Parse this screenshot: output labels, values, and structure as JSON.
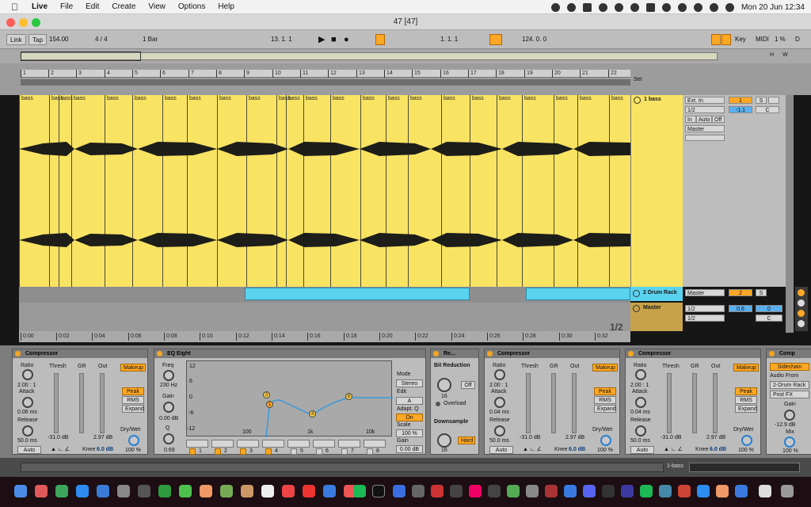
{
  "menubar": {
    "app": "Live",
    "items": [
      "File",
      "Edit",
      "Create",
      "View",
      "Options",
      "Help"
    ],
    "clock": "Mon 20 Jun  12:34"
  },
  "window": {
    "title": "47  [47]"
  },
  "control": {
    "link": "Link",
    "tap": "Tap",
    "tempo": "154.00",
    "signature": "4 / 4",
    "quant": "1 Bar",
    "position": "13.  1.  1",
    "loop_start": "1.  1.  1",
    "loop_length": "124.  0.  0",
    "key": "Key",
    "midi": "MIDI",
    "cpu": "1 %",
    "d": "D"
  },
  "overview": {
    "h": "H",
    "w": "W"
  },
  "ruler": {
    "bars": [
      "1",
      "2",
      "3",
      "4",
      "5",
      "6",
      "7",
      "8",
      "9",
      "10",
      "11",
      "12",
      "13",
      "14",
      "15",
      "16",
      "17",
      "18",
      "19",
      "20",
      "21",
      "22"
    ],
    "set": "Set"
  },
  "tracks": {
    "bass": {
      "name": "1 bass",
      "clip_label": "bass",
      "input": "Ext. In",
      "channel": "1/2",
      "monitor": [
        "In",
        "Auto",
        "Off"
      ],
      "output": "Master",
      "number": "1",
      "volume": "-1.1",
      "solo": "S",
      "pan": "C"
    },
    "drum": {
      "name": "2 Drum Rack",
      "output": "Master",
      "number": "2",
      "solo": "S",
      "volume": "-1.0",
      "pan": "C"
    },
    "master": {
      "name": "Master",
      "in": "1/2",
      "out": "1/2",
      "volume": "0.6",
      "vol2": "0",
      "pan": "C",
      "fraction": "1/2"
    }
  },
  "timeline": [
    "0:00",
    "0:02",
    "0:04",
    "0:06",
    "0:08",
    "0:10",
    "0:12",
    "0:14",
    "0:16",
    "0:18",
    "0:20",
    "0:22",
    "0:24",
    "0:26",
    "0:28",
    "0:30",
    "0:32"
  ],
  "devices": {
    "comp1": {
      "title": "Compressor",
      "ratio": "Ratio",
      "ratio_val": "2.00 : 1",
      "attack": "Attack",
      "attack_val": "0.06 ms",
      "release": "Release",
      "release_val": "50.0 ms",
      "auto": "Auto",
      "thresh": "Thresh",
      "gr": "GR",
      "out": "Out",
      "thresh_val": "-31.0 dB",
      "out_val": "2.97 dB",
      "makeup": "Makeup",
      "peak": "Peak",
      "rms": "RMS",
      "expand": "Expand",
      "drywet": "Dry/Wet",
      "drywet_val": "100 %",
      "knee": "Knee",
      "knee_val": "6.0 dB"
    },
    "eq": {
      "title": "EQ Eight",
      "freq": "Freq",
      "freq_val": "230 Hz",
      "gain": "Gain",
      "gain_val": "0.00 dB",
      "q": "Q",
      "q_val": "0.69",
      "db_ticks": [
        "12",
        "6",
        "0",
        "-6",
        "-12"
      ],
      "freq_ticks": [
        "100",
        "1k",
        "10k"
      ],
      "bands": [
        "1",
        "2",
        "3",
        "4",
        "5",
        "6",
        "7",
        "8"
      ],
      "mode": "Mode",
      "mode_val": "Stereo",
      "edit": "Edit",
      "edit_val": "A",
      "adapt": "Adapt. Q",
      "adapt_val": "On",
      "scale": "Scale",
      "scale_val": "100 %",
      "gain2": "Gain",
      "gain2_val": "0.00 dB",
      "band_markers": [
        "3",
        "1",
        "4",
        "6"
      ]
    },
    "bit": {
      "title": "Re...",
      "heading": "Bit Reduction",
      "bits": "16",
      "off": "Off",
      "overload": "Overload",
      "downsample": "Downsample",
      "ds_val": "16",
      "hard": "Hard"
    },
    "comp2": {
      "title": "Compressor",
      "ratio": "Ratio",
      "ratio_val": "2.00 : 1",
      "attack": "Attack",
      "attack_val": "0.04 ms",
      "release": "Release",
      "release_val": "50.0 ms",
      "auto": "Auto",
      "thresh": "Thresh",
      "gr": "GR",
      "out": "Out",
      "thresh_val": "-31.0 dB",
      "out_val": "2.97 dB",
      "makeup": "Makeup",
      "peak": "Peak",
      "rms": "RMS",
      "expand": "Expand",
      "drywet": "Dry/Wet",
      "drywet_val": "100 %",
      "knee": "Knee",
      "knee_val": "6.0 dB"
    },
    "comp3": {
      "title": "Compressor",
      "ratio": "Ratio",
      "ratio_val": "2.00 : 1",
      "attack": "Attack",
      "attack_val": "0.04 ms",
      "release": "Release",
      "release_val": "50.0 ms",
      "auto": "Auto",
      "thresh": "Thresh",
      "gr": "GR",
      "out": "Out",
      "thresh_val": "-31.0 dB",
      "out_val": "2.97 dB",
      "makeup": "Makeup",
      "peak": "Peak",
      "rms": "RMS",
      "expand": "Expand",
      "drywet": "Dry/Wet",
      "drywet_val": "100 %",
      "knee": "Knee",
      "knee_val": "6.0 dB"
    },
    "comp4": {
      "title": "Comp",
      "sidechain": "Sidechain",
      "audio_from": "Audio From",
      "source": "2-Drum Rack",
      "post": "Post FX",
      "gain": "Gain",
      "gain_val": "-12.9 dB",
      "mix": "Mix",
      "mix_val": "100 %"
    }
  },
  "status": {
    "track": "1-bass"
  },
  "colors": {
    "clip": "#f9e363",
    "drum": "#5ad3ef",
    "accent": "#ffa726"
  }
}
